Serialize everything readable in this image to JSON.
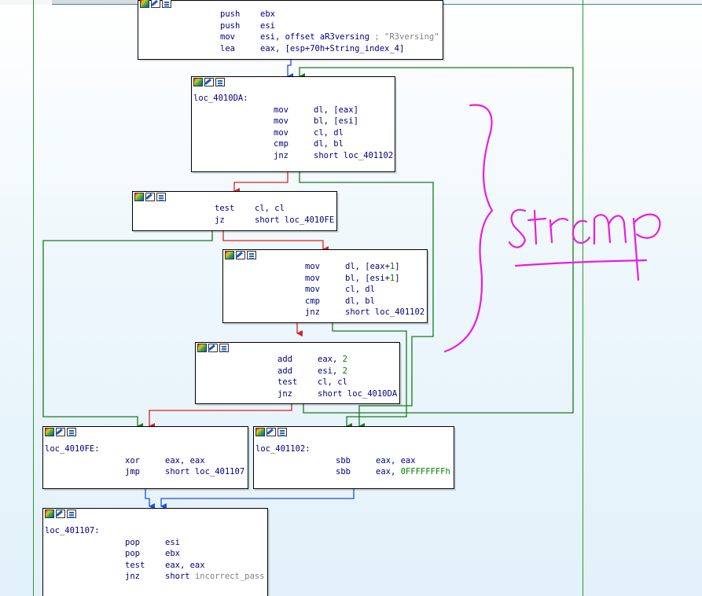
{
  "nodes": {
    "top": {
      "lines": [
        {
          "mn": "push",
          "a": "ebx"
        },
        {
          "mn": "push",
          "a": "esi"
        },
        {
          "mn": "mov",
          "a": "esi, offset aR3versing",
          "comment": " ; \"R3versing\""
        },
        {
          "mn": "lea",
          "a": "eax, [esp+70h+String_index_4]"
        }
      ]
    },
    "loc_4010DA": {
      "label": "loc_4010DA:",
      "lines": [
        {
          "mn": "mov",
          "a": "dl, [eax]"
        },
        {
          "mn": "mov",
          "a": "bl, [esi]"
        },
        {
          "mn": "mov",
          "a": "cl, dl"
        },
        {
          "mn": "cmp",
          "a": "dl, bl"
        },
        {
          "mn": "jnz",
          "a": "short loc_401102"
        }
      ]
    },
    "test1": {
      "lines": [
        {
          "mn": "test",
          "a": "cl, cl"
        },
        {
          "mn": "jz",
          "a": "short loc_4010FE"
        }
      ]
    },
    "block2": {
      "lines": [
        {
          "mn": "mov",
          "a": "dl, [eax+",
          "num": "1",
          "b": "]"
        },
        {
          "mn": "mov",
          "a": "bl, [esi+",
          "num": "1",
          "b": "]"
        },
        {
          "mn": "mov",
          "a": "cl, dl"
        },
        {
          "mn": "cmp",
          "a": "dl, bl"
        },
        {
          "mn": "jnz",
          "a": "short loc_401102"
        }
      ]
    },
    "block3": {
      "lines": [
        {
          "mn": "add",
          "a": "eax, ",
          "num": "2"
        },
        {
          "mn": "add",
          "a": "esi, ",
          "num": "2"
        },
        {
          "mn": "test",
          "a": "cl, cl"
        },
        {
          "mn": "jnz",
          "a": "short loc_4010DA"
        }
      ]
    },
    "loc_4010FE": {
      "label": "loc_4010FE:",
      "lines": [
        {
          "mn": "xor",
          "a": "eax, eax"
        },
        {
          "mn": "jmp",
          "a": "short loc_401107"
        }
      ]
    },
    "loc_401102": {
      "label": "loc_401102:",
      "lines": [
        {
          "mn": "sbb",
          "a": "eax, eax"
        },
        {
          "mn": "sbb",
          "a": "eax, ",
          "num": "0FFFFFFFFh"
        }
      ]
    },
    "loc_401107": {
      "label": "loc_401107:",
      "lines": [
        {
          "mn": "pop",
          "a": "esi"
        },
        {
          "mn": "pop",
          "a": "ebx"
        },
        {
          "mn": "test",
          "a": "eax, eax"
        },
        {
          "mn": "jnz",
          "a": "short ",
          "gray": "incorrect_pass"
        }
      ]
    }
  },
  "annotation": {
    "text": "strcmp",
    "color": "#e81ee0"
  },
  "colors": {
    "true_branch": "#1a7a1a",
    "false_branch": "#e0201a",
    "unconditional": "#1f4fd8",
    "loop_edge": "#1a7a1a",
    "instruction": "#000080",
    "number": "#008000",
    "comment": "#808080",
    "border": "#2a9a2a"
  }
}
